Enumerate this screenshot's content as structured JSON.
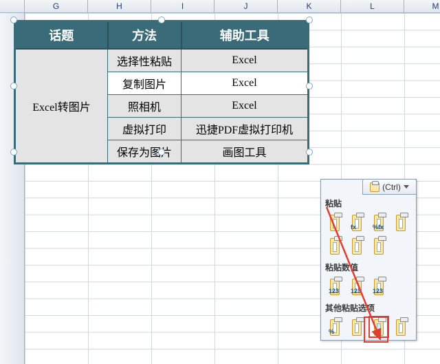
{
  "columns": [
    "G",
    "H",
    "I",
    "J",
    "K",
    "L",
    "M"
  ],
  "table": {
    "headers": [
      "话题",
      "方法",
      "辅助工具"
    ],
    "topic": "Excel转图片",
    "rows": [
      {
        "method": "选择性粘贴",
        "tool": "Excel"
      },
      {
        "method": "复制图片",
        "tool": "Excel"
      },
      {
        "method": "照相机",
        "tool": "Excel"
      },
      {
        "method": "虚拟打印",
        "tool": "迅捷PDF虚拟打印机"
      },
      {
        "method": "保存为图片",
        "tool": "画图工具"
      }
    ]
  },
  "paste": {
    "button_label": "(Ctrl)",
    "sections": {
      "s1": "粘贴",
      "s2": "粘贴数值",
      "s3": "其他粘贴选项"
    },
    "selected_option": "paste-picture",
    "icons": {
      "fx": {
        "badge": "fx"
      },
      "pfx": {
        "badge": "%fx"
      },
      "v123a": {
        "badge": "123"
      },
      "v123b": {
        "badge": "123"
      },
      "v123c": {
        "badge": "123"
      },
      "pct": {
        "badge": "%"
      }
    }
  },
  "chart_data": {
    "type": "table",
    "title": "",
    "headers": [
      "话题",
      "方法",
      "辅助工具"
    ],
    "rows": [
      [
        "Excel转图片",
        "选择性粘贴",
        "Excel"
      ],
      [
        "Excel转图片",
        "复制图片",
        "Excel"
      ],
      [
        "Excel转图片",
        "照相机",
        "Excel"
      ],
      [
        "Excel转图片",
        "虚拟打印",
        "迅捷PDF虚拟打印机"
      ],
      [
        "Excel转图片",
        "保存为图片",
        "画图工具"
      ]
    ]
  }
}
